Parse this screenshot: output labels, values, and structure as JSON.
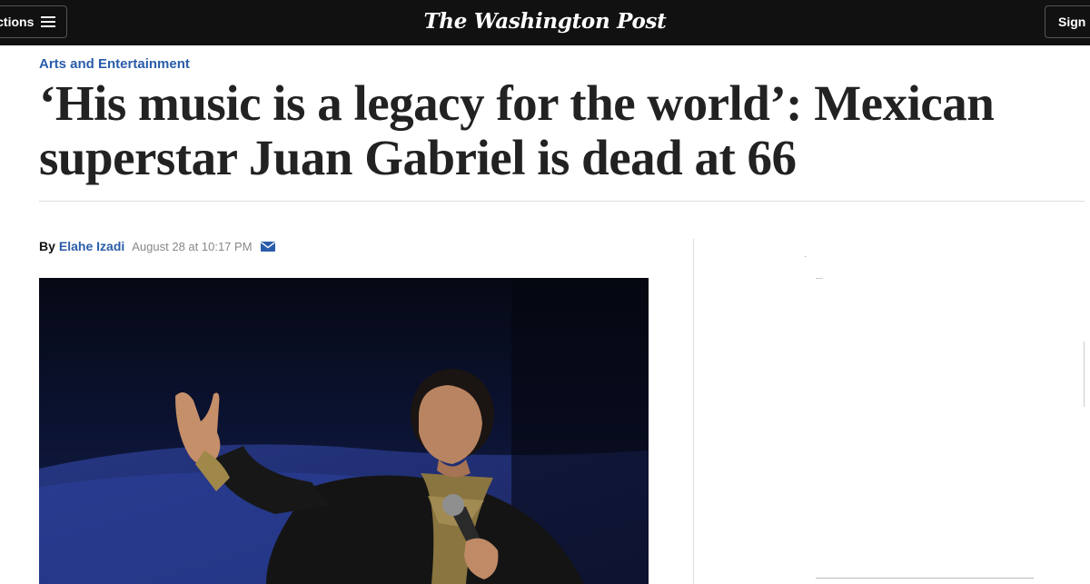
{
  "header": {
    "sections_label": "Sections",
    "logo_text": "The Washington Post",
    "signin_label": "Sign In"
  },
  "article": {
    "kicker": "Arts and Entertainment",
    "headline": "‘His music is a legacy for the world’: Mexican superstar Juan Gabriel is dead at 66",
    "byline_prefix": "By",
    "author": "Elahe Izadi",
    "date": "August 28 at 10:17 PM"
  },
  "colors": {
    "topbar": "#111111",
    "link_blue": "#2a5caa",
    "headline": "#222222"
  },
  "icons": {
    "menu": "hamburger-icon",
    "share": "mail-icon"
  }
}
